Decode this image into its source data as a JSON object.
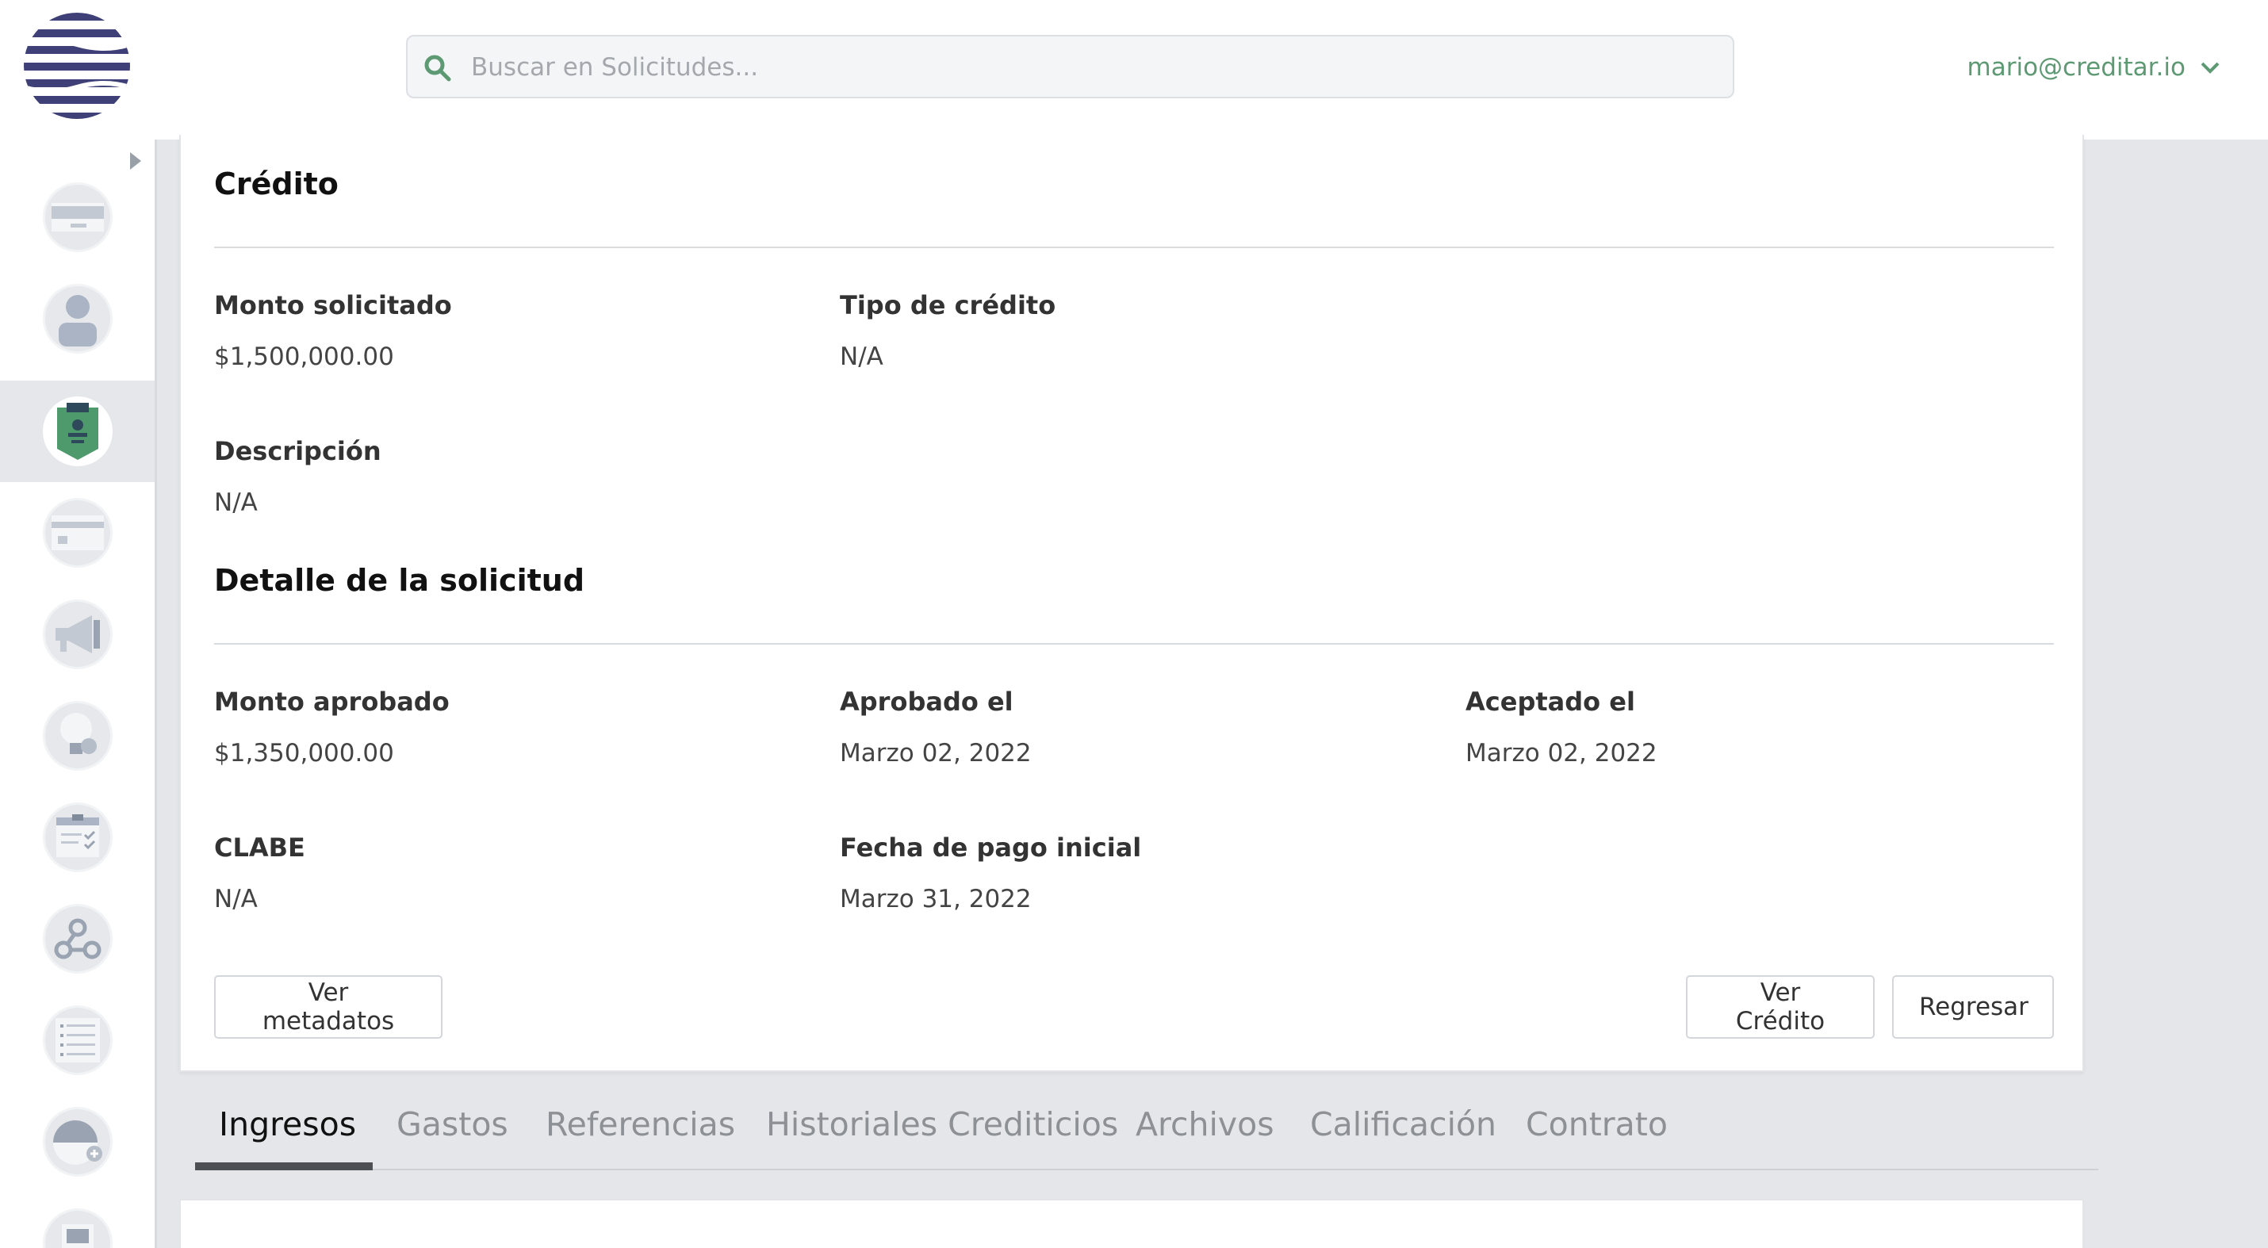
{
  "header": {
    "search_placeholder": "Buscar en Solicitudes...",
    "user_email": "mario@creditar.io"
  },
  "sidebar": {
    "items": [
      {
        "icon": "card-icon"
      },
      {
        "icon": "user-icon"
      },
      {
        "icon": "clipboard-user-icon",
        "active": true
      },
      {
        "icon": "credit-card-icon"
      },
      {
        "icon": "megaphone-icon"
      },
      {
        "icon": "lightbulb-coin-icon"
      },
      {
        "icon": "checklist-icon"
      },
      {
        "icon": "webhook-icon"
      },
      {
        "icon": "list-icon"
      },
      {
        "icon": "gauge-plus-icon"
      },
      {
        "icon": "document-icon"
      }
    ]
  },
  "credito": {
    "title": "Crédito",
    "monto_solicitado_label": "Monto solicitado",
    "monto_solicitado_value": "$1,500,000.00",
    "tipo_credito_label": "Tipo de crédito",
    "tipo_credito_value": "N/A",
    "descripcion_label": "Descripción",
    "descripcion_value": "N/A"
  },
  "detalle": {
    "title": "Detalle de la solicitud",
    "monto_aprobado_label": "Monto aprobado",
    "monto_aprobado_value": "$1,350,000.00",
    "aprobado_el_label": "Aprobado el",
    "aprobado_el_value": "Marzo 02, 2022",
    "aceptado_el_label": "Aceptado el",
    "aceptado_el_value": "Marzo 02, 2022",
    "clabe_label": "CLABE",
    "clabe_value": "N/A",
    "fecha_pago_label": "Fecha de pago inicial",
    "fecha_pago_value": "Marzo 31, 2022"
  },
  "actions": {
    "ver_metadatos": "Ver metadatos",
    "ver_credito": "Ver Crédito",
    "regresar": "Regresar"
  },
  "tabs": [
    {
      "label": "Ingresos",
      "active": true
    },
    {
      "label": "Gastos"
    },
    {
      "label": "Referencias"
    },
    {
      "label": "Historiales Crediticios"
    },
    {
      "label": "Archivos"
    },
    {
      "label": "Calificación"
    },
    {
      "label": "Contrato"
    }
  ],
  "colors": {
    "accent_green": "#5d9a73",
    "logo_navy": "#3f4077",
    "active_icon_green": "#4f9a6d"
  }
}
